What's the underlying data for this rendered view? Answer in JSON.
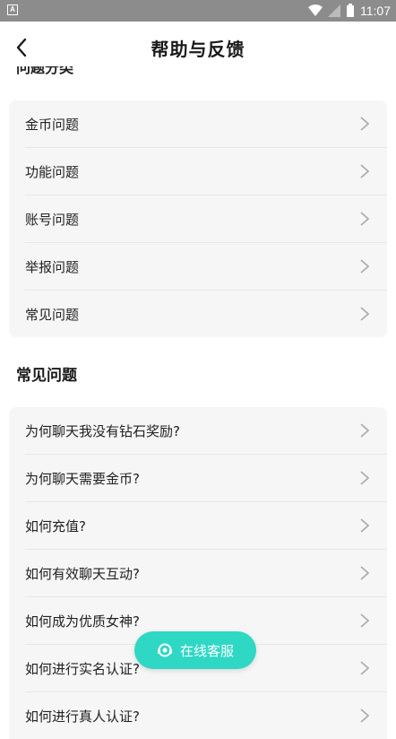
{
  "status_bar": {
    "time": "11:07"
  },
  "header": {
    "title": "帮助与反馈"
  },
  "clipped_section": {
    "title": "问题分类"
  },
  "categories": [
    {
      "label": "金币问题"
    },
    {
      "label": "功能问题"
    },
    {
      "label": "账号问题"
    },
    {
      "label": "举报问题"
    },
    {
      "label": "常见问题"
    }
  ],
  "faq": {
    "title": "常见问题",
    "items": [
      {
        "label": "为何聊天我没有钻石奖励?"
      },
      {
        "label": "为何聊天需要金币?"
      },
      {
        "label": "如何充值?"
      },
      {
        "label": "如何有效聊天互动?"
      },
      {
        "label": "如何成为优质女神?"
      },
      {
        "label": "如何进行实名认证?"
      },
      {
        "label": "如何进行真人认证?"
      }
    ]
  },
  "fab": {
    "label": "在线客服",
    "color": "#2fd8c4"
  }
}
